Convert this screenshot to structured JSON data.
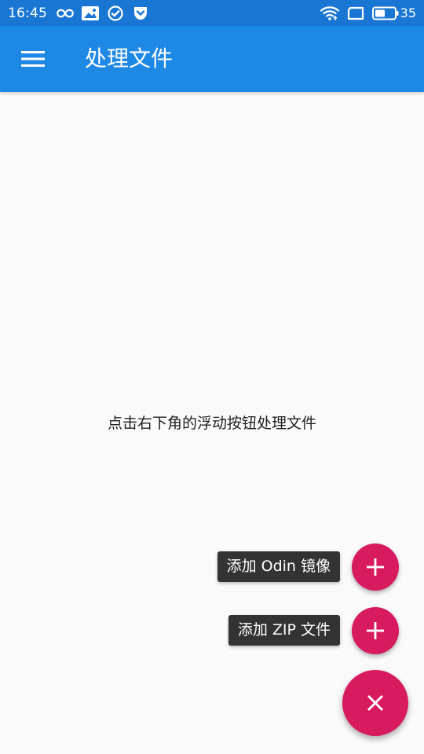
{
  "status_bar": {
    "time": "16:45",
    "battery_level": "35",
    "icons": [
      "infinity-icon",
      "image-notification-icon",
      "check-circle-icon",
      "pocket-icon",
      "wifi-icon",
      "screen-rotation-icon",
      "battery-icon"
    ]
  },
  "app_bar": {
    "title": "处理文件",
    "menu_icon": "hamburger-menu-icon"
  },
  "main": {
    "empty_hint": "点击右下角的浮动按钮处理文件"
  },
  "fab_menu": {
    "add_odin_label": "添加 Odin 镜像",
    "add_zip_label": "添加 ZIP 文件",
    "main_icon": "close-icon",
    "item_icon": "plus-icon"
  },
  "colors": {
    "status_bar": "#1976d2",
    "app_bar": "#1e88e5",
    "fab": "#d81b60",
    "background": "#fafafa",
    "label_bg": "#333333"
  }
}
